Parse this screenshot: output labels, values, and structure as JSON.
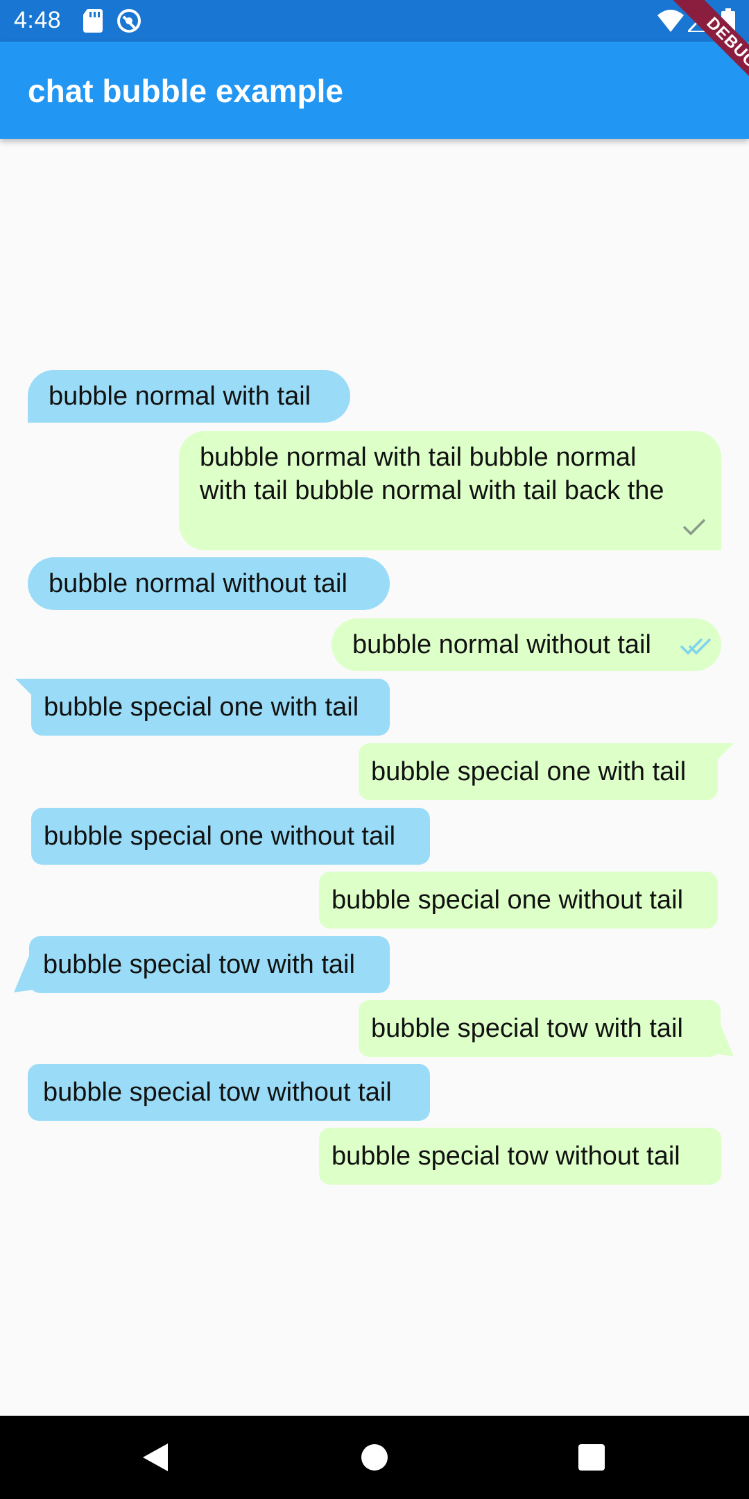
{
  "status_bar": {
    "time": "4:48",
    "icons": [
      "sd-card-icon",
      "sync-icon",
      "wifi-icon",
      "signal-icon",
      "battery-icon"
    ]
  },
  "debug_banner": "DEBUG",
  "app_bar": {
    "title": "chat bubble example"
  },
  "colors": {
    "status_bar": "#1976d2",
    "app_bar": "#2196f3",
    "sender_bubble": "#9adcf7",
    "receiver_bubble": "#ddffc8",
    "background": "#fafafa"
  },
  "messages": [
    {
      "text": "bubble normal with tail",
      "side": "left",
      "style": "normal",
      "tail": true
    },
    {
      "text": "bubble normal with tail bubble normal with tail bubble normal with tail back the",
      "side": "right",
      "style": "normal",
      "tail": true,
      "status": "sent"
    },
    {
      "text": "bubble normal without tail",
      "side": "left",
      "style": "normal",
      "tail": false
    },
    {
      "text": "bubble normal without tail",
      "side": "right",
      "style": "normal",
      "tail": false,
      "status": "seen"
    },
    {
      "text": "bubble special one with tail",
      "side": "left",
      "style": "special-one",
      "tail": true
    },
    {
      "text": "bubble special one with tail",
      "side": "right",
      "style": "special-one",
      "tail": true
    },
    {
      "text": "bubble special one without tail",
      "side": "left",
      "style": "special-one",
      "tail": false
    },
    {
      "text": "bubble special one without tail",
      "side": "right",
      "style": "special-one",
      "tail": false
    },
    {
      "text": "bubble special tow with tail",
      "side": "left",
      "style": "special-two",
      "tail": true
    },
    {
      "text": "bubble special tow with tail",
      "side": "right",
      "style": "special-two",
      "tail": true
    },
    {
      "text": "bubble special tow without tail",
      "side": "left",
      "style": "special-two",
      "tail": false
    },
    {
      "text": "bubble special tow without tail",
      "side": "right",
      "style": "special-two",
      "tail": false
    }
  ],
  "nav_bar": {
    "buttons": [
      "back-icon",
      "home-icon",
      "recent-apps-icon"
    ]
  }
}
